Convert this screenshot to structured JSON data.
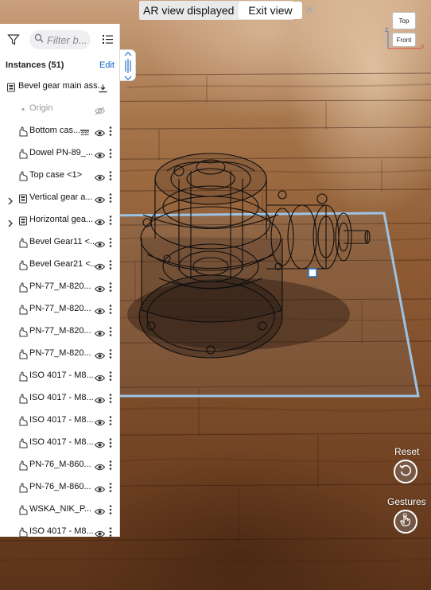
{
  "ar_banner": {
    "status": "AR view displayed",
    "exit_label": "Exit view",
    "close_icon": "close-icon"
  },
  "view_cube": {
    "top_label": "Top",
    "front_label": "Front",
    "axis_z": "Z",
    "axis_x": "X"
  },
  "panel": {
    "search_placeholder": "Filter b...",
    "instances_label": "Instances (51)",
    "edit_label": "Edit",
    "rows": [
      {
        "label": "Bevel gear main ass...",
        "icon": "assembly-icon",
        "extra": "download-icon",
        "eye": false,
        "more": false,
        "expand": false,
        "indent": 0
      },
      {
        "label": "Origin",
        "icon": "origin-icon",
        "dim": true,
        "eye": "hidden",
        "more": false,
        "expand": false,
        "indent": 1
      },
      {
        "label": "Bottom cas...",
        "icon": "part-icon",
        "extra": "section-icon",
        "eye": true,
        "more": true,
        "expand": false,
        "indent": 1
      },
      {
        "label": "Dowel PN-89_...",
        "icon": "part-icon",
        "eye": true,
        "more": true,
        "expand": false,
        "indent": 1
      },
      {
        "label": "Top case <1>",
        "icon": "part-icon",
        "eye": true,
        "more": true,
        "expand": false,
        "indent": 1
      },
      {
        "label": "Vertical gear a...",
        "icon": "assembly-icon",
        "eye": true,
        "more": true,
        "expand": true,
        "indent": 1
      },
      {
        "label": "Horizontal gea...",
        "icon": "assembly-icon",
        "eye": true,
        "more": true,
        "expand": true,
        "indent": 1
      },
      {
        "label": "Bevel Gear11 <...",
        "icon": "part-icon",
        "eye": true,
        "more": true,
        "expand": false,
        "indent": 1
      },
      {
        "label": "Bevel Gear21 <...",
        "icon": "part-icon",
        "eye": true,
        "more": true,
        "expand": false,
        "indent": 1
      },
      {
        "label": "PN-77_M-820...",
        "icon": "part-icon",
        "eye": true,
        "more": true,
        "expand": false,
        "indent": 1
      },
      {
        "label": "PN-77_M-820...",
        "icon": "part-icon",
        "eye": true,
        "more": true,
        "expand": false,
        "indent": 1
      },
      {
        "label": "PN-77_M-820...",
        "icon": "part-icon",
        "eye": true,
        "more": true,
        "expand": false,
        "indent": 1
      },
      {
        "label": "PN-77_M-820...",
        "icon": "part-icon",
        "eye": true,
        "more": true,
        "expand": false,
        "indent": 1
      },
      {
        "label": "ISO 4017 - M8...",
        "icon": "part-icon",
        "eye": true,
        "more": true,
        "expand": false,
        "indent": 1
      },
      {
        "label": "ISO 4017 - M8...",
        "icon": "part-icon",
        "eye": true,
        "more": true,
        "expand": false,
        "indent": 1
      },
      {
        "label": "ISO 4017 - M8...",
        "icon": "part-icon",
        "eye": true,
        "more": true,
        "expand": false,
        "indent": 1
      },
      {
        "label": "ISO 4017 - M8...",
        "icon": "part-icon",
        "eye": true,
        "more": true,
        "expand": false,
        "indent": 1
      },
      {
        "label": "PN-76_M-860...",
        "icon": "part-icon",
        "eye": true,
        "more": true,
        "expand": false,
        "indent": 1
      },
      {
        "label": "PN-76_M-860...",
        "icon": "part-icon",
        "eye": true,
        "more": true,
        "expand": false,
        "indent": 1
      },
      {
        "label": "WSKA_NIK_P...",
        "icon": "part-icon",
        "eye": true,
        "more": true,
        "expand": false,
        "indent": 1
      },
      {
        "label": "ISO 4017 - M8...",
        "icon": "part-icon",
        "eye": true,
        "more": true,
        "expand": false,
        "indent": 1
      }
    ]
  },
  "controls": {
    "reset_label": "Reset",
    "gestures_label": "Gestures"
  },
  "colors": {
    "accent": "#0a63c9",
    "plane_outline": "#9cc3e4",
    "floor": "#8d5a33"
  }
}
